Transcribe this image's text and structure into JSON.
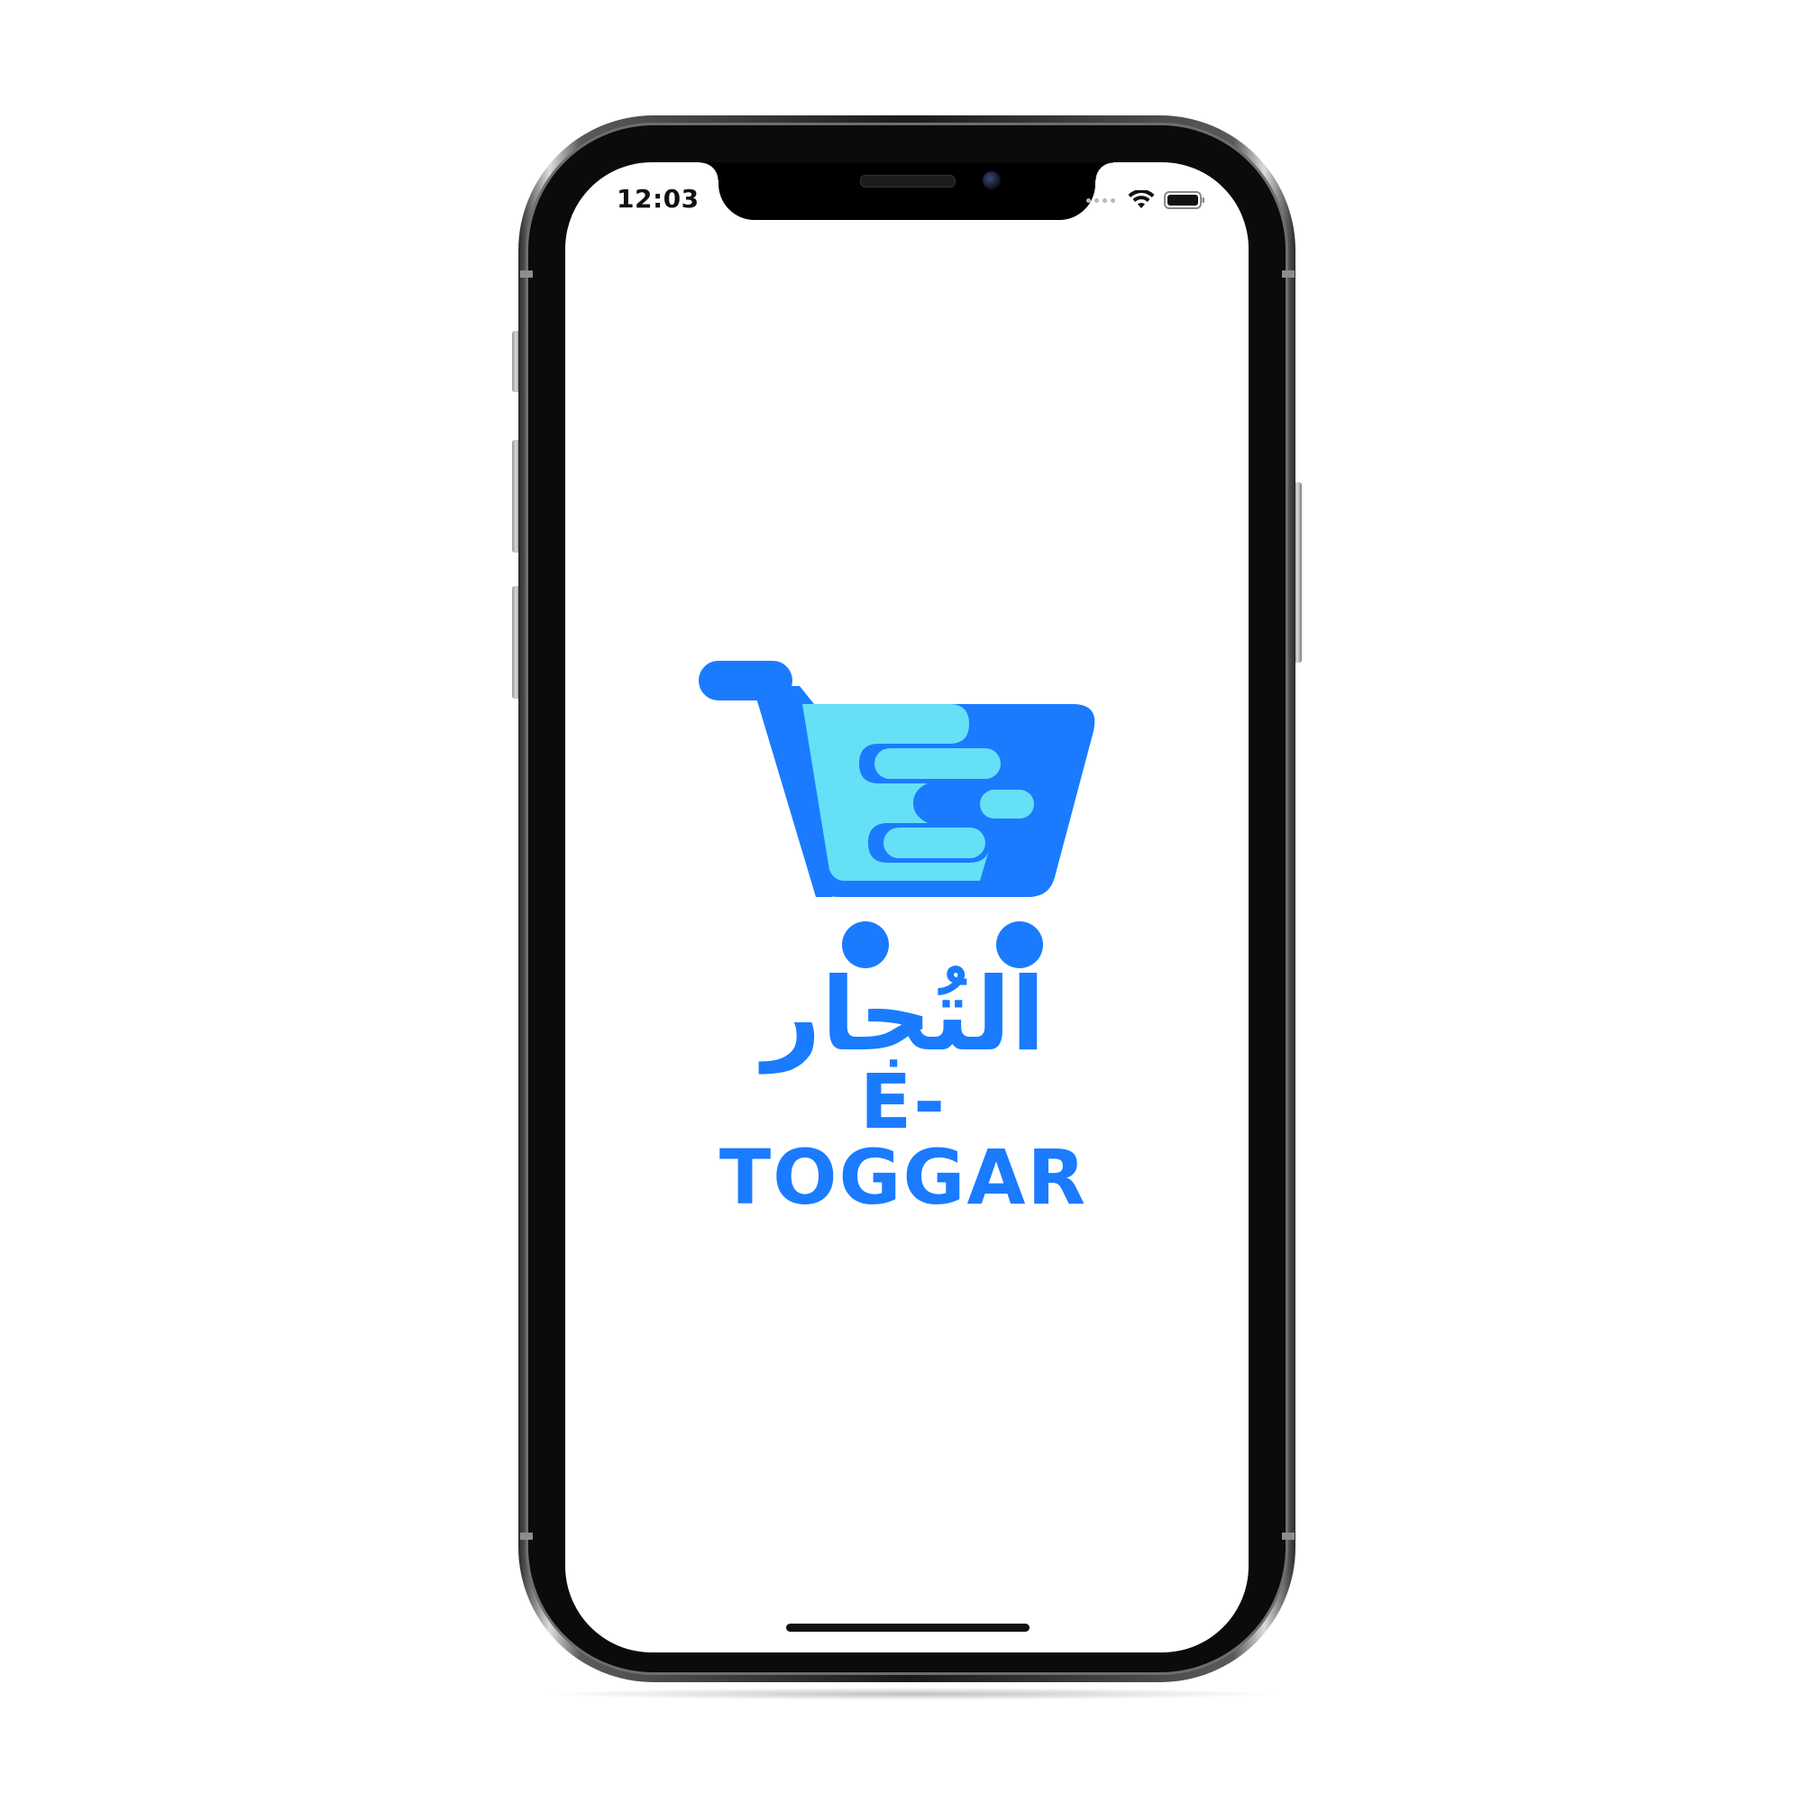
{
  "status_bar": {
    "time": "12:03",
    "wifi_icon": "wifi-icon",
    "battery_icon": "battery-icon",
    "signal_icon": "signal-dots-icon"
  },
  "splash": {
    "logo_icon": "shopping-cart-icon",
    "arabic_name": "التُجار",
    "latin_name": "E-TOGGAR"
  },
  "colors": {
    "brand_blue": "#1a7bff",
    "brand_cyan": "#66e0f7",
    "background": "#ffffff"
  }
}
